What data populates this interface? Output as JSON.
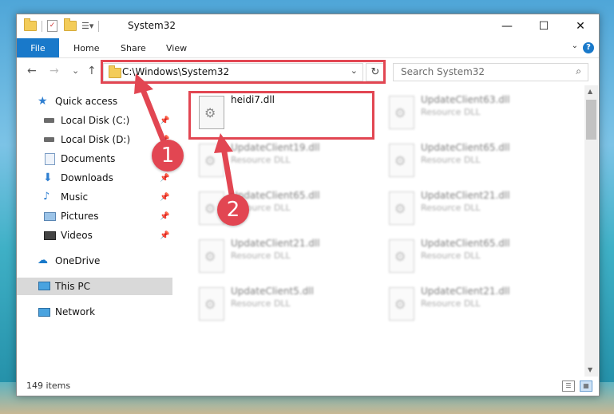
{
  "window": {
    "title": "System32",
    "minimize": "—",
    "maximize": "☐",
    "close": "✕"
  },
  "ribbon": {
    "file": "File",
    "home": "Home",
    "share": "Share",
    "view": "View",
    "help": "?"
  },
  "nav": {
    "back": "←",
    "forward": "→",
    "recent": "⌄",
    "up": "↑",
    "address": "C:\\Windows\\System32",
    "refresh": "↻",
    "search_placeholder": "Search System32"
  },
  "sidebar": {
    "items": [
      {
        "label": "Quick access",
        "icon": "star-icon"
      },
      {
        "label": "Local Disk (C:)",
        "icon": "drive-icon"
      },
      {
        "label": "Local Disk (D:)",
        "icon": "drive-icon"
      },
      {
        "label": "Documents",
        "icon": "documents-icon"
      },
      {
        "label": "Downloads",
        "icon": "download-icon"
      },
      {
        "label": "Music",
        "icon": "music-icon"
      },
      {
        "label": "Pictures",
        "icon": "pictures-icon"
      },
      {
        "label": "Videos",
        "icon": "video-icon"
      },
      {
        "label": "OneDrive",
        "icon": "cloud-icon"
      },
      {
        "label": "This PC",
        "icon": "computer-icon"
      },
      {
        "label": "Network",
        "icon": "network-icon"
      }
    ]
  },
  "files": [
    {
      "name": "heidi7.dll",
      "type": ""
    },
    {
      "name": "UpdateClient19.dll",
      "type": "Resource DLL"
    },
    {
      "name": "UpdateClient65.dll",
      "type": "Resource DLL"
    },
    {
      "name": "UpdateClient21.dll",
      "type": "Resource DLL"
    },
    {
      "name": "UpdateClient5.dll",
      "type": "Resource DLL"
    },
    {
      "name": "UpdateClient63.dll",
      "type": "Resource DLL"
    },
    {
      "name": "UpdateClient65.dll",
      "type": "Resource DLL"
    },
    {
      "name": "UpdateClient21.dll",
      "type": "Resource DLL"
    },
    {
      "name": "UpdateClient65.dll",
      "type": "Resource DLL"
    },
    {
      "name": "UpdateClient21.dll",
      "type": "Resource DLL"
    }
  ],
  "status": {
    "count": "149 items"
  },
  "annotations": {
    "badge1": "1",
    "badge2": "2",
    "color": "#e24652"
  },
  "colors": {
    "accent": "#1979ca",
    "annotation": "#e24652"
  }
}
